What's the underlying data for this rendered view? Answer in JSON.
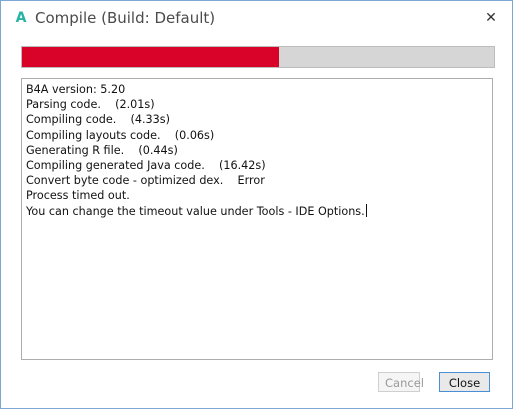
{
  "window": {
    "title": "Compile (Build: Default)",
    "app_icon_glyph": "A",
    "app_icon_name": "b4a-app-icon",
    "close_glyph": "✕",
    "close_icon_name": "close-icon"
  },
  "progress": {
    "value": 0.545,
    "fill_color": "#d9032a",
    "track_color": "#d6d6d6"
  },
  "log": {
    "lines": [
      "B4A version: 5.20",
      "Parsing code.    (2.01s)",
      "Compiling code.    (4.33s)",
      "Compiling layouts code.    (0.06s)",
      "Generating R file.    (0.44s)",
      "Compiling generated Java code.    (16.42s)",
      "Convert byte code - optimized dex.    Error",
      "Process timed out.",
      "You can change the timeout value under Tools - IDE Options."
    ]
  },
  "buttons": {
    "cancel_label": "Cancel",
    "cancel_enabled": false,
    "close_label": "Close"
  },
  "colors": {
    "accent": "#26b3a6",
    "error_red": "#d9032a",
    "focus_border": "#4a8ed6"
  }
}
